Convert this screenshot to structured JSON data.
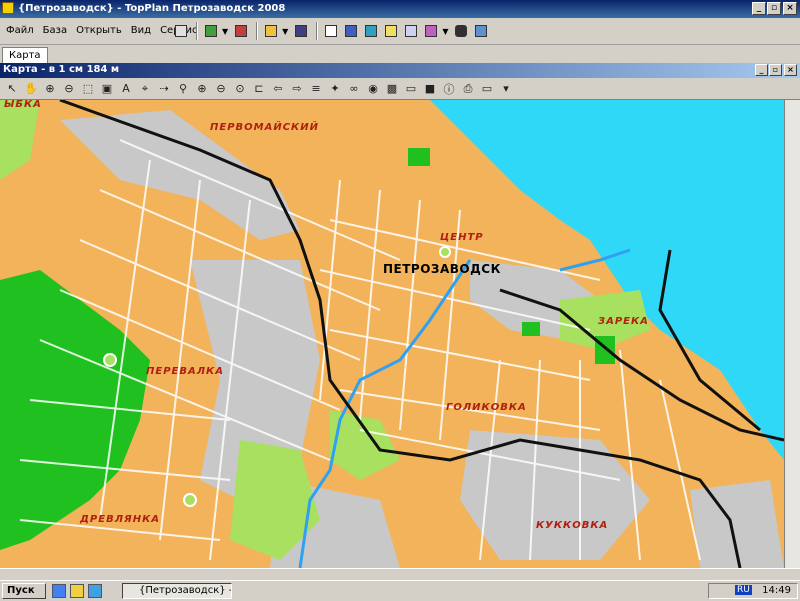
{
  "window": {
    "title": "{Петрозаводск} - TopPlan Петрозаводск 2008",
    "buttons": [
      "_",
      "▫",
      "×"
    ]
  },
  "menu": [
    "Файл",
    "База",
    "Открыть",
    "Вид",
    "Сервис",
    "?"
  ],
  "tabs": [
    {
      "label": "Карта"
    }
  ],
  "map_window": {
    "title": "Карта - в 1 см 184 м"
  },
  "map": {
    "city_label": "ПЕТРОЗАВОДСК",
    "districts": [
      "ЫБКА",
      "ПЕРВОМАЙСКИЙ",
      "ЦЕНТР",
      "ЗАРЕКА",
      "ПЕРЕВАЛКА",
      "ГОЛИКОВКА",
      "ДРЕВЛЯНКА",
      "КУККОВКА"
    ]
  },
  "taskbar": {
    "start_label": "Пуск",
    "task_item": "{Петрозаводск} - Top...",
    "language": "RU",
    "clock": "14:49"
  },
  "colors": {
    "urban": "#f2b35a",
    "water": "#30d8f8",
    "park": "#a8e060",
    "forest": "#20c020",
    "industrial": "#c8c8c8",
    "title_bar": "#0a246a"
  }
}
